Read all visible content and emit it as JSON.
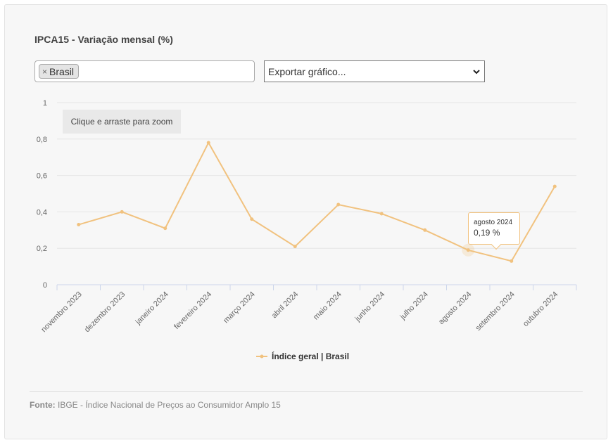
{
  "title": "IPCA15 - Variação mensal (%)",
  "filter": {
    "chip_remove": "×",
    "chip_label": "Brasil"
  },
  "export": {
    "label": "Exportar gráfico..."
  },
  "zoom_hint": "Clique e arraste para zoom",
  "tooltip": {
    "label": "agosto 2024",
    "value": "0,19 %"
  },
  "legend": {
    "label": "Índice geral | Brasil",
    "color": "#f1c27f"
  },
  "source": {
    "prefix": "Fonte:",
    "text": "IBGE - Índice Nacional de Preços ao Consumidor Amplo 15"
  },
  "chart_data": {
    "type": "line",
    "title": "IPCA15 - Variação mensal (%)",
    "categories": [
      "novembro 2023",
      "dezembro 2023",
      "janeiro 2024",
      "fevereiro 2024",
      "março 2024",
      "abril 2024",
      "maio 2024",
      "junho 2024",
      "julho 2024",
      "agosto 2024",
      "setembro 2024",
      "outubro 2024"
    ],
    "series": [
      {
        "name": "Índice geral | Brasil",
        "values": [
          0.33,
          0.4,
          0.31,
          0.78,
          0.36,
          0.21,
          0.44,
          0.39,
          0.3,
          0.19,
          0.13,
          0.54
        ],
        "color": "#f1c27f"
      }
    ],
    "ylim": [
      0,
      1
    ],
    "yticks": [
      0,
      0.2,
      0.4,
      0.6,
      0.8,
      1
    ],
    "ytick_labels": [
      "0",
      "0,2",
      "0,4",
      "0,6",
      "0,8",
      "1"
    ],
    "grid": true,
    "highlighted_index": 9,
    "legend_position": "bottom-center"
  }
}
